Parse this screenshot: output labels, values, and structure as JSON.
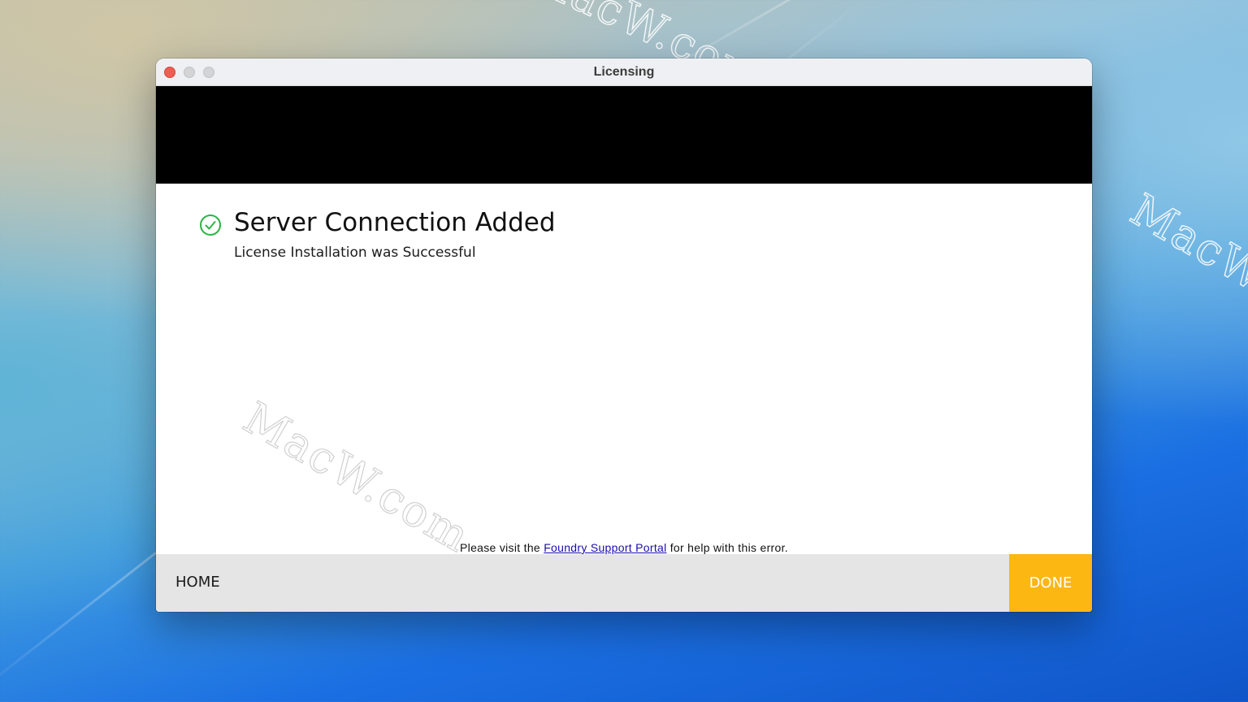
{
  "window": {
    "title": "Licensing"
  },
  "message": {
    "icon": "check-circle-icon",
    "heading": "Server Connection Added",
    "subheading": "License Installation was Successful"
  },
  "help": {
    "prefix": "Please visit the ",
    "link_label": "Foundry Support Portal",
    "suffix": " for help with this error."
  },
  "footer": {
    "home_label": "HOME",
    "done_label": "DONE"
  },
  "watermarks": {
    "text": "MacW.com"
  },
  "colors": {
    "accent": "#fdb713",
    "success": "#2fb344",
    "close": "#ee5e55"
  }
}
